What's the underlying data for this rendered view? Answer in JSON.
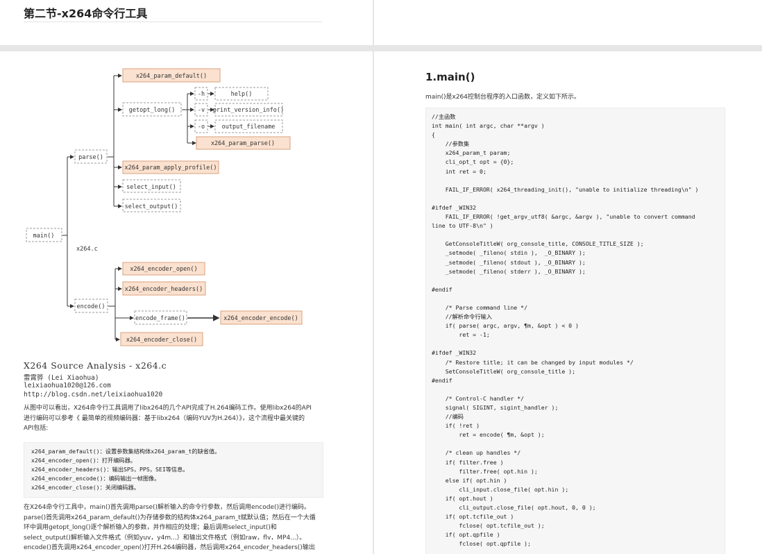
{
  "header": {
    "title": "第二节-x264命令行工具"
  },
  "diagram": {
    "nodes": {
      "x264_param_default": "x264_param_default()",
      "getopt_long": "getopt_long()",
      "opt_h": "-h",
      "opt_v": "-v",
      "opt_o": "-o",
      "help": "help()",
      "print_version_info": "print_version_info()",
      "output_filename": "output_filename",
      "x264_param_parse": "x264_param_parse()",
      "parse": "parse()",
      "x264_param_apply_profile": "x264_param_apply_profile()",
      "select_input": "select_input()",
      "select_output": "select_output()",
      "main": "main()",
      "x264c": "x264.c",
      "x264_encoder_open": "x264_encoder_open()",
      "x264_encoder_headers": "x264_encoder_headers()",
      "encode": "encode()",
      "encode_frame": "encode_frame()",
      "x264_encoder_encode": "x264_encoder_encode()",
      "x264_encoder_close": "x264_encoder_close()"
    },
    "caption": {
      "title": "X264 Source Analysis - x264.c",
      "author": "雷霄骅 (Lei Xiaohua)",
      "email": "leixiaohua1020@126.com",
      "url": "http://blog.csdn.net/leixiaohua1020"
    }
  },
  "left_text": {
    "para1_line1": "从图中可以看出，X264命令行工具调用了libx264的几个API完成了H.264编码工作。使用libx264的API",
    "para1_line2": "进行编码可以参考《 最简单的视频编码器：基于libx264（编码YUV为H.264）》，这个流程中最关键的",
    "para1_line3": "API包括:",
    "code": [
      "x264_param_default()：设置参数集结构体x264_param_t的缺省值。",
      "x264_encoder_open()：打开编码器。",
      "x264_encoder_headers()：输出SPS，PPS，SEI等信息。",
      "x264_encoder_encode()：编码输出一帧图像。",
      "x264_encoder_close()：关闭编码器。"
    ],
    "para2_line1": "在X264命令行工具中，main()首先调用parse()解析输入的命令行参数，然后调用encode()进行编码。",
    "para2_line2": "parse()首先调用x264_param_default()为存储参数的结构体x264_param_t赋默认值；然后在一个大循",
    "para2_line3": "环中调用getopt_long()逐个解析输入的参数，并作相应的处理；最后调用select_input()和",
    "para2_line4": "select_output()解析输入文件格式（例如yuv，y4m...）和输出文件格式（例如raw，flv，MP4...）。",
    "para2_line5": "encode()首先调用x264_encoder_open()打开H.264编码器，然后调用x264_encoder_headers()输出"
  },
  "right": {
    "heading": "1.main()",
    "intro": "main()是x264控制台程序的入口函数，定义如下所示。",
    "code_lines": [
      "//主函数",
      "int main( int argc, char **argv )",
      "{",
      "    //参数集",
      "    x264_param_t param;",
      "    cli_opt_t opt = {0};",
      "    int ret = 0;",
      "",
      "    FAIL_IF_ERROR( x264_threading_init(), \"unable to initialize threading\\n\" )",
      "",
      "#ifdef _WIN32",
      "    FAIL_IF_ERROR( !get_argv_utf8( &argc, &argv ), \"unable to convert command",
      "line to UTF-8\\n\" )",
      "",
      "    GetConsoleTitleW( org_console_title, CONSOLE_TITLE_SIZE );",
      "    _setmode( _fileno( stdin ),  _O_BINARY );",
      "    _setmode( _fileno( stdout ), _O_BINARY );",
      "    _setmode( _fileno( stderr ), _O_BINARY );",
      "",
      "#endif",
      "",
      "    /* Parse command line */",
      "    //解析命令行输入",
      "    if( parse( argc, argv, ¶m, &opt ) < 0 )",
      "        ret = -1;",
      "",
      "#ifdef _WIN32",
      "    /* Restore title; it can be changed by input modules */",
      "    SetConsoleTitleW( org_console_title );",
      "#endif",
      "",
      "    /* Control-C handler */",
      "    signal( SIGINT, sigint_handler );",
      "    //编码",
      "    if( !ret )",
      "        ret = encode( ¶m, &opt );",
      "",
      "    /* clean up handles */",
      "    if( filter.free )",
      "        filter.free( opt.hin );",
      "    else if( opt.hin )",
      "        cli_input.close_file( opt.hin );",
      "    if( opt.hout )",
      "        cli_output.close_file( opt.hout, 0, 0 );",
      "    if( opt.tcfile_out )",
      "        fclose( opt.tcfile_out );",
      "    if( opt.qpfile )",
      "        fclose( opt.qpfile );"
    ]
  },
  "colors": {
    "api_box_fill": "#fbe1cf",
    "api_box_stroke": "#d9a27c",
    "dashed_box_stroke": "#9a9a9a",
    "code_bg": "#f6f6f6",
    "page_gap": "#e6e6e6"
  }
}
